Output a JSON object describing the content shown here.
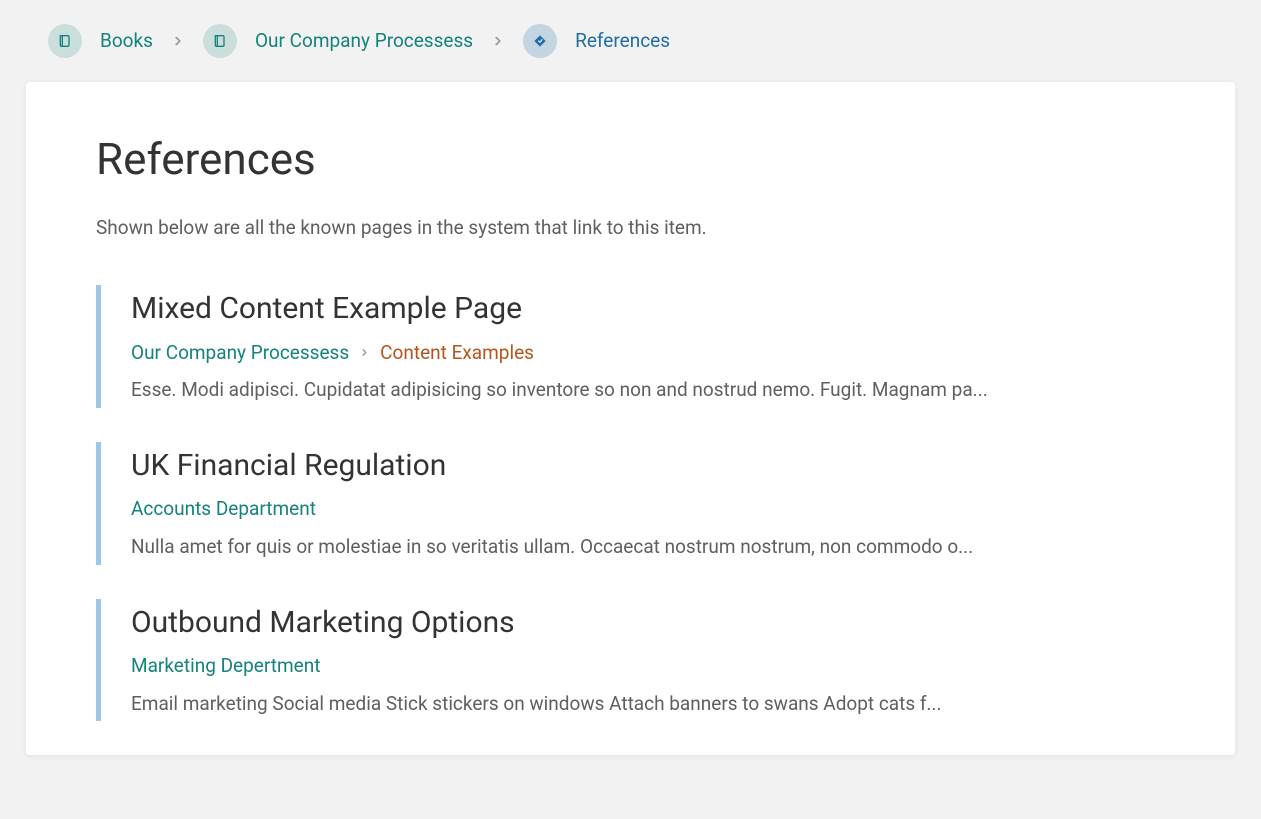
{
  "breadcrumbs": {
    "root": {
      "label": "Books"
    },
    "book": {
      "label": "Our Company Processess"
    },
    "page": {
      "label": "References"
    }
  },
  "header": {
    "title": "References",
    "intro": "Shown below are all the known pages in the system that link to this item."
  },
  "references": [
    {
      "title": "Mixed Content Example Page",
      "path_book": "Our Company Processess",
      "path_chapter": "Content Examples",
      "excerpt": "Esse. Modi adipisci. Cupidatat adipisicing so inventore so non and nostrud nemo. Fugit. Magnam pa..."
    },
    {
      "title": "UK Financial Regulation",
      "path_book": "Accounts Department",
      "path_chapter": "",
      "excerpt": "Nulla amet for quis or molestiae in so veritatis ullam. Occaecat nostrum nostrum, non commodo o..."
    },
    {
      "title": "Outbound Marketing Options",
      "path_book": "Marketing Depertment",
      "path_chapter": "",
      "excerpt": "Email marketing Social media Stick stickers on windows Attach banners to swans Adopt cats f..."
    }
  ]
}
